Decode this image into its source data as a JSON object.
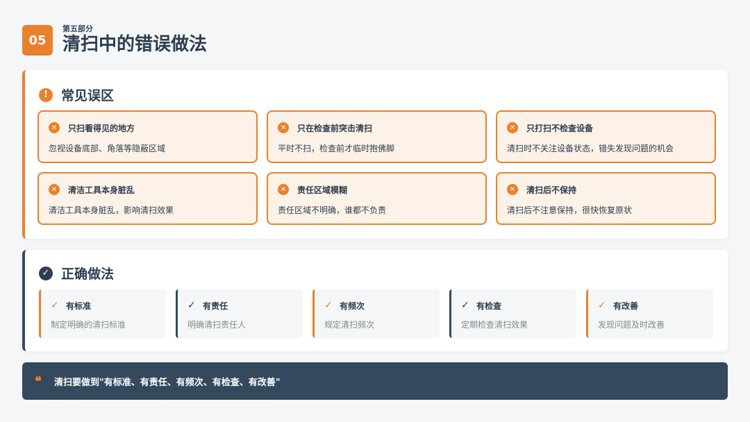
{
  "header": {
    "badge": "05",
    "subtitle": "第五部分",
    "title": "清扫中的错误做法"
  },
  "mistakes": {
    "title": "常见误区",
    "icon": "exclamation-circle-icon",
    "items": [
      {
        "title": "只扫看得见的地方",
        "desc": "忽视设备底部、角落等隐蔽区域"
      },
      {
        "title": "只在检查前突击清扫",
        "desc": "平时不扫，检查前才临时抱佛脚"
      },
      {
        "title": "只打扫不检查设备",
        "desc": "清扫时不关注设备状态，错失发现问题的机会"
      },
      {
        "title": "清洁工具本身脏乱",
        "desc": "清洁工具本身脏乱，影响清扫效果"
      },
      {
        "title": "责任区域模糊",
        "desc": "责任区域不明确，谁都不负责"
      },
      {
        "title": "清扫后不保持",
        "desc": "清扫后不注意保持，很快恢复原状"
      }
    ]
  },
  "correct": {
    "title": "正确做法",
    "icon": "check-circle-icon",
    "items": [
      {
        "title": "有标准",
        "desc": "制定明确的清扫标准",
        "accent": "orange"
      },
      {
        "title": "有责任",
        "desc": "明确清扫责任人",
        "accent": "navy"
      },
      {
        "title": "有频次",
        "desc": "规定清扫频次",
        "accent": "orange"
      },
      {
        "title": "有检查",
        "desc": "定期检查清扫效果",
        "accent": "navy"
      },
      {
        "title": "有改善",
        "desc": "发现问题及时改善",
        "accent": "orange"
      }
    ]
  },
  "quote": {
    "mark": "❝",
    "text": "清扫要做到\"有标准、有责任、有频次、有检查、有改善\""
  },
  "colors": {
    "accent": "#e9812b",
    "navy": "#34495e",
    "mistake_bg": "#fdf2e7"
  }
}
